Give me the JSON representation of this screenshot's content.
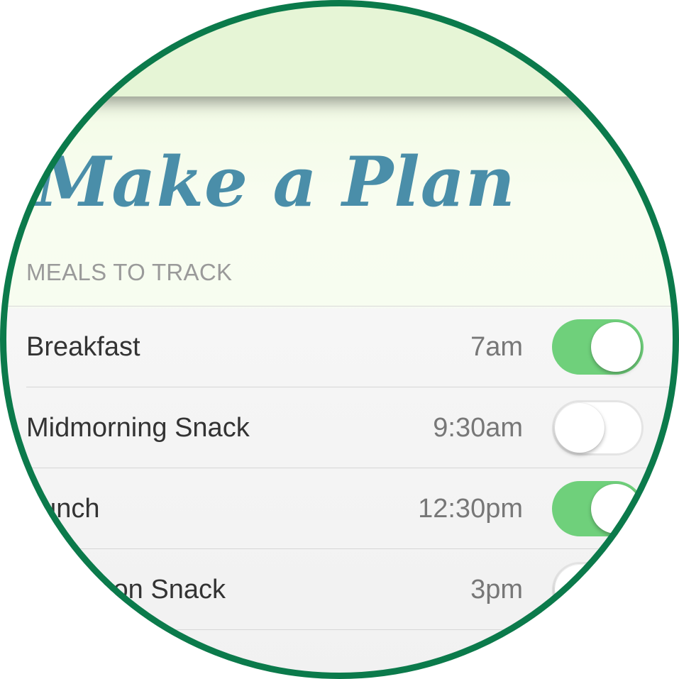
{
  "page": {
    "title": "Make a Plan",
    "section_header": "MEALS TO TRACK"
  },
  "meals": [
    {
      "name": "Breakfast",
      "time": "7am",
      "enabled": true
    },
    {
      "name": "Midmorning Snack",
      "time": "9:30am",
      "enabled": false
    },
    {
      "name": "Lunch",
      "time": "12:30pm",
      "enabled": true
    },
    {
      "name": "Afternoon Snack",
      "time": "3pm",
      "enabled": false
    }
  ],
  "colors": {
    "title": "#4a8ea9",
    "toggle_on": "#6fd07b",
    "nav_bar": "#e6f5d6",
    "ring": "#0b7a4b"
  }
}
